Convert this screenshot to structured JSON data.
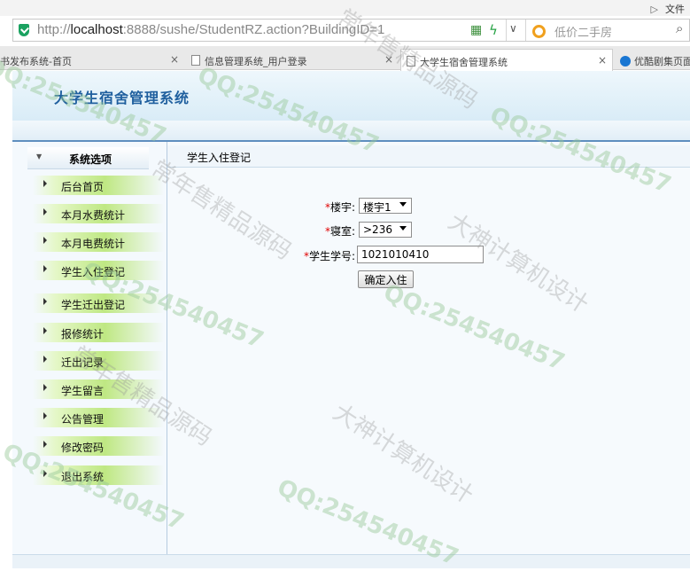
{
  "browser": {
    "menu_label": "文件",
    "url_prefix": "http://",
    "url_host": "localhost",
    "url_rest": ":8888/sushe/StudentRZ.action?BuildingID=1",
    "search_placeholder": "低价二手房",
    "tabs": [
      {
        "label": "书发布系统-首页",
        "close": "×"
      },
      {
        "label": "信息管理系统_用户登录",
        "close": "×"
      },
      {
        "label": "大学生宿舍管理系统",
        "close": "×"
      },
      {
        "label": "优酷剧集页面",
        "close": ""
      }
    ]
  },
  "header": {
    "title": "大学生宿舍管理系统"
  },
  "sidebar": {
    "title": "系统选项",
    "items": [
      {
        "label": "后台首页"
      },
      {
        "label": "本月水费统计"
      },
      {
        "label": "本月电费统计"
      },
      {
        "label": "学生入住登记"
      },
      {
        "label": "学生迁出登记"
      },
      {
        "label": "报修统计"
      },
      {
        "label": "迁出记录"
      },
      {
        "label": "学生留言"
      },
      {
        "label": "公告管理"
      },
      {
        "label": "修改密码"
      },
      {
        "label": "退出系统"
      }
    ]
  },
  "main": {
    "title": "学生入住登记",
    "form": {
      "required_mark": "*",
      "building_label": "楼宇:",
      "building_value": "楼宇1",
      "room_label": "寝室:",
      "room_value": ">236",
      "student_id_label": "学生学号:",
      "student_id_value": "1021010410",
      "submit_label": "确定入住"
    }
  },
  "watermark": {
    "qq": "QQ:254540457",
    "shop": "常年售精品源码",
    "design": "大神计算机设计"
  }
}
